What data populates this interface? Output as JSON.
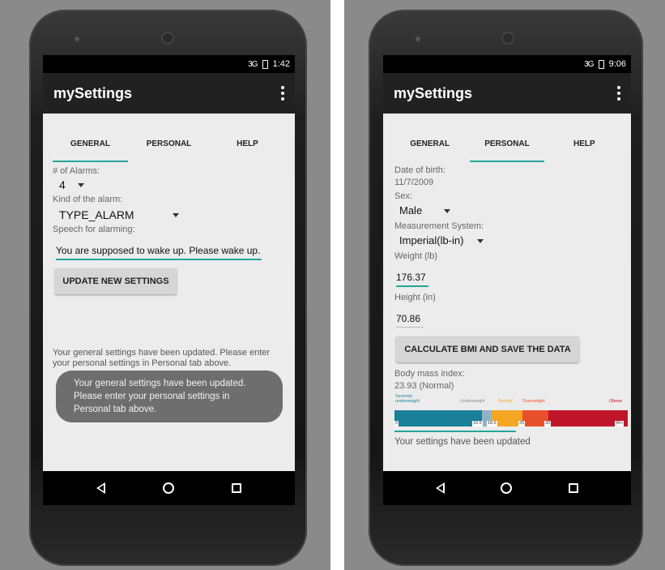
{
  "left_screen": {
    "status_time": "1:42",
    "status_network": "3G",
    "app_title": "mySettings",
    "tabs": [
      "GENERAL",
      "PERSONAL",
      "HELP"
    ],
    "active_tab": "GENERAL",
    "alarms_label": "# of Alarms:",
    "alarms_value": "4",
    "kind_label": "Kind of the alarm:",
    "kind_value": "TYPE_ALARM",
    "speech_label": "Speech for alarming:",
    "speech_value": "You are supposed to wake up. Please wake up.",
    "update_button": "UPDATE NEW SETTINGS",
    "status_message": "Your general settings have been updated. Please enter your personal settings in Personal tab above.",
    "toast_message": "Your general settings have been updated. Please enter your personal settings in Personal tab above."
  },
  "right_screen": {
    "status_time": "9:06",
    "status_network": "3G",
    "app_title": "mySettings",
    "tabs": [
      "GENERAL",
      "PERSONAL",
      "HELP"
    ],
    "active_tab": "PERSONAL",
    "dob_label": "Date of birth:",
    "dob_value": "11/7/2009",
    "sex_label": "Sex:",
    "sex_value": "Male",
    "measure_label": "Measurement System:",
    "measure_value": "Imperial(lb-in)",
    "weight_label": "Weight (lb)",
    "weight_value": "176.37",
    "height_label": "Height (in)",
    "height_value": "70.86",
    "calc_button": "CALCULATE BMI AND SAVE THE DATA",
    "bmi_label": "Body mass index:",
    "bmi_value": "23.93 (Normal)",
    "bmi_chart": {
      "categories": [
        {
          "name": "Severely underweight",
          "color": "#1a7f98"
        },
        {
          "name": "Underweight",
          "color": "#8fb3c6"
        },
        {
          "name": "Normal",
          "color": "#f5a623"
        },
        {
          "name": "Overweight",
          "color": "#e8502a"
        },
        {
          "name": "Obese",
          "color": "#c0142a"
        }
      ],
      "ticks": [
        "0",
        "16.5",
        "18.5",
        "25",
        "30",
        "40+"
      ]
    },
    "status_message": "Your settings have been updated"
  },
  "colors": {
    "accent": "#26a69a",
    "appbar": "#212121"
  }
}
